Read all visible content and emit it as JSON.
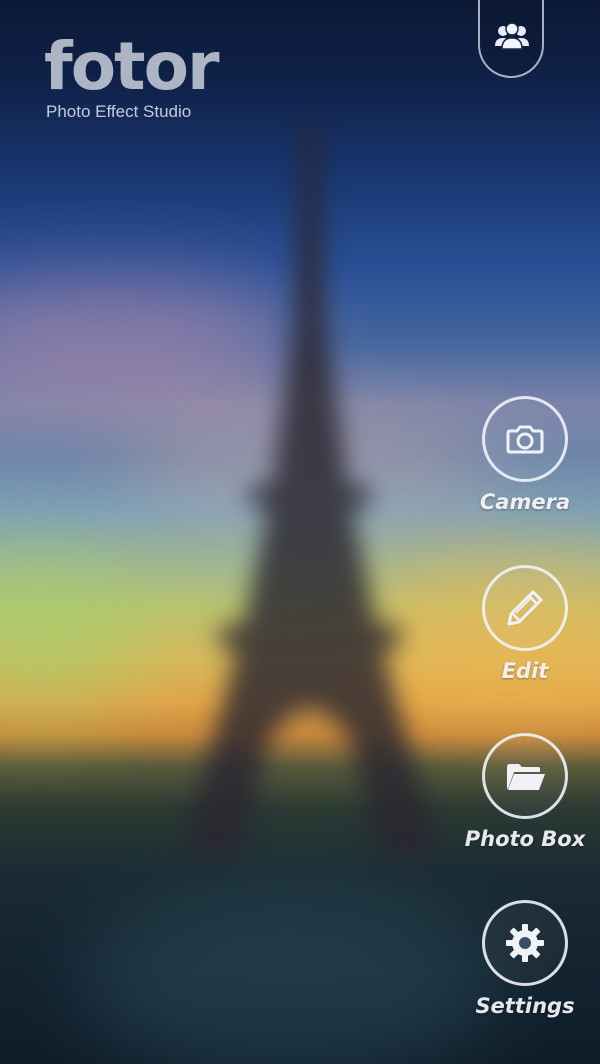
{
  "app": {
    "logo_text": "fotor",
    "tagline": "Photo Effect Studio"
  },
  "header": {
    "friends_icon": "users-icon"
  },
  "menu": [
    {
      "id": "camera",
      "label": "Camera",
      "icon": "camera-icon"
    },
    {
      "id": "edit",
      "label": "Edit",
      "icon": "pencil-icon"
    },
    {
      "id": "photobox",
      "label": "Photo Box",
      "icon": "folder-icon"
    },
    {
      "id": "settings",
      "label": "Settings",
      "icon": "gear-icon"
    }
  ],
  "colors": {
    "icon_stroke": "#f0f2f8",
    "sky_top": "#0c1936",
    "sunset": "#e0a448"
  }
}
